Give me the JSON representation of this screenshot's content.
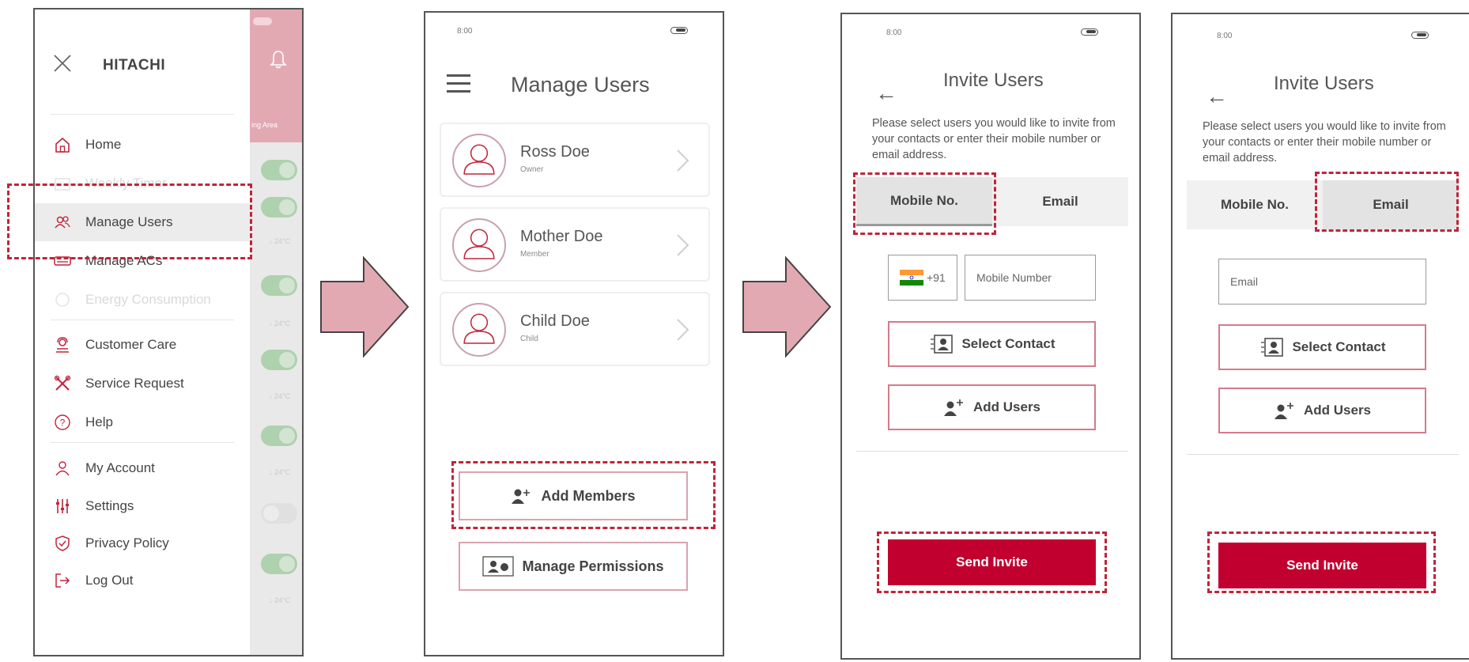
{
  "colors": {
    "brand_red": "#c2002f",
    "highlight_dash": "#c0253a",
    "arrow_fill": "#e3a9b3",
    "header_pink": "#e3a9b3",
    "toggle_green": "#8fc58f"
  },
  "menu_screen": {
    "brand": "HITACHI",
    "close_icon": "close-icon",
    "items": [
      {
        "label": "Home",
        "icon": "home-icon",
        "state": "normal"
      },
      {
        "label": "Weekly Timer",
        "icon": "timer-icon",
        "state": "disabled"
      },
      {
        "label": "Manage Users",
        "icon": "users-icon",
        "state": "active"
      },
      {
        "label": "Manage ACs",
        "icon": "ac-icon",
        "state": "normal"
      },
      {
        "label": "Energy Consumption",
        "icon": "energy-icon",
        "state": "disabled"
      },
      {
        "label": "Customer Care",
        "icon": "customer-care-icon",
        "state": "normal"
      },
      {
        "label": "Service Request",
        "icon": "tools-icon",
        "state": "normal"
      },
      {
        "label": "Help",
        "icon": "help-icon",
        "state": "normal"
      },
      {
        "label": "My Account",
        "icon": "account-icon",
        "state": "normal"
      },
      {
        "label": "Settings",
        "icon": "sliders-icon",
        "state": "normal"
      },
      {
        "label": "Privacy Policy",
        "icon": "shield-icon",
        "state": "normal"
      },
      {
        "label": "Log Out",
        "icon": "logout-icon",
        "state": "normal"
      }
    ]
  },
  "manage_users_screen": {
    "time": "8:00",
    "title": "Manage Users",
    "users": [
      {
        "name": "Ross Doe",
        "role": "Owner"
      },
      {
        "name": "Mother Doe",
        "role": "Member"
      },
      {
        "name": "Child Doe",
        "role": "Child"
      }
    ],
    "add_members_label": "Add Members",
    "manage_permissions_label": "Manage Permissions"
  },
  "invite_mobile_screen": {
    "time": "8:00",
    "title": "Invite Users",
    "description": "Please select users you would like to invite from your contacts or enter their mobile number or email address.",
    "tab_mobile": "Mobile No.",
    "tab_email": "Email",
    "active_tab": "Mobile No.",
    "country_code": "+91",
    "mobile_placeholder": "Mobile Number",
    "select_contact_label": "Select Contact",
    "add_users_label": "Add Users",
    "send_invite_label": "Send Invite"
  },
  "invite_email_screen": {
    "time": "8:00",
    "title": "Invite Users",
    "description": "Please select users you would like to invite from your contacts or enter their mobile number or email address.",
    "tab_mobile": "Mobile No.",
    "tab_email": "Email",
    "active_tab": "Email",
    "email_placeholder": "Email",
    "select_contact_label": "Select Contact",
    "add_users_label": "Add Users",
    "send_invite_label": "Send Invite"
  }
}
